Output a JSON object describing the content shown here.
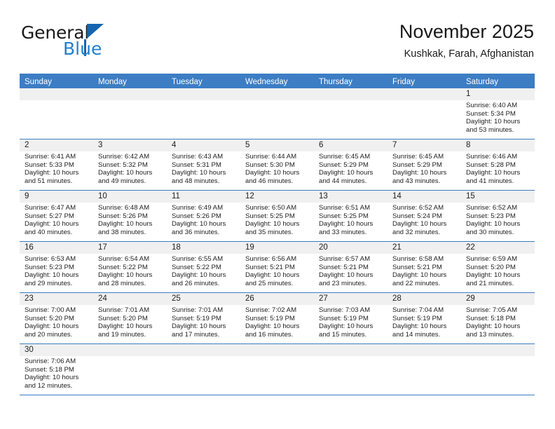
{
  "brand": {
    "name_part1": "General",
    "name_part2": "Blue",
    "accent_color": "#1f7fd1",
    "triangle_color": "#1565b0"
  },
  "header": {
    "title": "November 2025",
    "location": "Kushkak, Farah, Afghanistan"
  },
  "calendar": {
    "header_bg": "#3c7dc4",
    "day_band_bg": "#f0f0f0",
    "weekdays": [
      "Sunday",
      "Monday",
      "Tuesday",
      "Wednesday",
      "Thursday",
      "Friday",
      "Saturday"
    ],
    "weeks": [
      [
        {
          "day": "",
          "sunrise": "",
          "sunset": "",
          "daylight": "",
          "empty": true
        },
        {
          "day": "",
          "sunrise": "",
          "sunset": "",
          "daylight": "",
          "empty": true
        },
        {
          "day": "",
          "sunrise": "",
          "sunset": "",
          "daylight": "",
          "empty": true
        },
        {
          "day": "",
          "sunrise": "",
          "sunset": "",
          "daylight": "",
          "empty": true
        },
        {
          "day": "",
          "sunrise": "",
          "sunset": "",
          "daylight": "",
          "empty": true
        },
        {
          "day": "",
          "sunrise": "",
          "sunset": "",
          "daylight": "",
          "empty": true
        },
        {
          "day": "1",
          "sunrise": "Sunrise: 6:40 AM",
          "sunset": "Sunset: 5:34 PM",
          "daylight": "Daylight: 10 hours and 53 minutes.",
          "empty": false
        }
      ],
      [
        {
          "day": "2",
          "sunrise": "Sunrise: 6:41 AM",
          "sunset": "Sunset: 5:33 PM",
          "daylight": "Daylight: 10 hours and 51 minutes.",
          "empty": false
        },
        {
          "day": "3",
          "sunrise": "Sunrise: 6:42 AM",
          "sunset": "Sunset: 5:32 PM",
          "daylight": "Daylight: 10 hours and 49 minutes.",
          "empty": false
        },
        {
          "day": "4",
          "sunrise": "Sunrise: 6:43 AM",
          "sunset": "Sunset: 5:31 PM",
          "daylight": "Daylight: 10 hours and 48 minutes.",
          "empty": false
        },
        {
          "day": "5",
          "sunrise": "Sunrise: 6:44 AM",
          "sunset": "Sunset: 5:30 PM",
          "daylight": "Daylight: 10 hours and 46 minutes.",
          "empty": false
        },
        {
          "day": "6",
          "sunrise": "Sunrise: 6:45 AM",
          "sunset": "Sunset: 5:29 PM",
          "daylight": "Daylight: 10 hours and 44 minutes.",
          "empty": false
        },
        {
          "day": "7",
          "sunrise": "Sunrise: 6:45 AM",
          "sunset": "Sunset: 5:29 PM",
          "daylight": "Daylight: 10 hours and 43 minutes.",
          "empty": false
        },
        {
          "day": "8",
          "sunrise": "Sunrise: 6:46 AM",
          "sunset": "Sunset: 5:28 PM",
          "daylight": "Daylight: 10 hours and 41 minutes.",
          "empty": false
        }
      ],
      [
        {
          "day": "9",
          "sunrise": "Sunrise: 6:47 AM",
          "sunset": "Sunset: 5:27 PM",
          "daylight": "Daylight: 10 hours and 40 minutes.",
          "empty": false
        },
        {
          "day": "10",
          "sunrise": "Sunrise: 6:48 AM",
          "sunset": "Sunset: 5:26 PM",
          "daylight": "Daylight: 10 hours and 38 minutes.",
          "empty": false
        },
        {
          "day": "11",
          "sunrise": "Sunrise: 6:49 AM",
          "sunset": "Sunset: 5:26 PM",
          "daylight": "Daylight: 10 hours and 36 minutes.",
          "empty": false
        },
        {
          "day": "12",
          "sunrise": "Sunrise: 6:50 AM",
          "sunset": "Sunset: 5:25 PM",
          "daylight": "Daylight: 10 hours and 35 minutes.",
          "empty": false
        },
        {
          "day": "13",
          "sunrise": "Sunrise: 6:51 AM",
          "sunset": "Sunset: 5:25 PM",
          "daylight": "Daylight: 10 hours and 33 minutes.",
          "empty": false
        },
        {
          "day": "14",
          "sunrise": "Sunrise: 6:52 AM",
          "sunset": "Sunset: 5:24 PM",
          "daylight": "Daylight: 10 hours and 32 minutes.",
          "empty": false
        },
        {
          "day": "15",
          "sunrise": "Sunrise: 6:52 AM",
          "sunset": "Sunset: 5:23 PM",
          "daylight": "Daylight: 10 hours and 30 minutes.",
          "empty": false
        }
      ],
      [
        {
          "day": "16",
          "sunrise": "Sunrise: 6:53 AM",
          "sunset": "Sunset: 5:23 PM",
          "daylight": "Daylight: 10 hours and 29 minutes.",
          "empty": false
        },
        {
          "day": "17",
          "sunrise": "Sunrise: 6:54 AM",
          "sunset": "Sunset: 5:22 PM",
          "daylight": "Daylight: 10 hours and 28 minutes.",
          "empty": false
        },
        {
          "day": "18",
          "sunrise": "Sunrise: 6:55 AM",
          "sunset": "Sunset: 5:22 PM",
          "daylight": "Daylight: 10 hours and 26 minutes.",
          "empty": false
        },
        {
          "day": "19",
          "sunrise": "Sunrise: 6:56 AM",
          "sunset": "Sunset: 5:21 PM",
          "daylight": "Daylight: 10 hours and 25 minutes.",
          "empty": false
        },
        {
          "day": "20",
          "sunrise": "Sunrise: 6:57 AM",
          "sunset": "Sunset: 5:21 PM",
          "daylight": "Daylight: 10 hours and 23 minutes.",
          "empty": false
        },
        {
          "day": "21",
          "sunrise": "Sunrise: 6:58 AM",
          "sunset": "Sunset: 5:21 PM",
          "daylight": "Daylight: 10 hours and 22 minutes.",
          "empty": false
        },
        {
          "day": "22",
          "sunrise": "Sunrise: 6:59 AM",
          "sunset": "Sunset: 5:20 PM",
          "daylight": "Daylight: 10 hours and 21 minutes.",
          "empty": false
        }
      ],
      [
        {
          "day": "23",
          "sunrise": "Sunrise: 7:00 AM",
          "sunset": "Sunset: 5:20 PM",
          "daylight": "Daylight: 10 hours and 20 minutes.",
          "empty": false
        },
        {
          "day": "24",
          "sunrise": "Sunrise: 7:01 AM",
          "sunset": "Sunset: 5:20 PM",
          "daylight": "Daylight: 10 hours and 19 minutes.",
          "empty": false
        },
        {
          "day": "25",
          "sunrise": "Sunrise: 7:01 AM",
          "sunset": "Sunset: 5:19 PM",
          "daylight": "Daylight: 10 hours and 17 minutes.",
          "empty": false
        },
        {
          "day": "26",
          "sunrise": "Sunrise: 7:02 AM",
          "sunset": "Sunset: 5:19 PM",
          "daylight": "Daylight: 10 hours and 16 minutes.",
          "empty": false
        },
        {
          "day": "27",
          "sunrise": "Sunrise: 7:03 AM",
          "sunset": "Sunset: 5:19 PM",
          "daylight": "Daylight: 10 hours and 15 minutes.",
          "empty": false
        },
        {
          "day": "28",
          "sunrise": "Sunrise: 7:04 AM",
          "sunset": "Sunset: 5:19 PM",
          "daylight": "Daylight: 10 hours and 14 minutes.",
          "empty": false
        },
        {
          "day": "29",
          "sunrise": "Sunrise: 7:05 AM",
          "sunset": "Sunset: 5:18 PM",
          "daylight": "Daylight: 10 hours and 13 minutes.",
          "empty": false
        }
      ],
      [
        {
          "day": "30",
          "sunrise": "Sunrise: 7:06 AM",
          "sunset": "Sunset: 5:18 PM",
          "daylight": "Daylight: 10 hours and 12 minutes.",
          "empty": false
        },
        {
          "day": "",
          "sunrise": "",
          "sunset": "",
          "daylight": "",
          "empty": true
        },
        {
          "day": "",
          "sunrise": "",
          "sunset": "",
          "daylight": "",
          "empty": true
        },
        {
          "day": "",
          "sunrise": "",
          "sunset": "",
          "daylight": "",
          "empty": true
        },
        {
          "day": "",
          "sunrise": "",
          "sunset": "",
          "daylight": "",
          "empty": true
        },
        {
          "day": "",
          "sunrise": "",
          "sunset": "",
          "daylight": "",
          "empty": true
        },
        {
          "day": "",
          "sunrise": "",
          "sunset": "",
          "daylight": "",
          "empty": true
        }
      ]
    ]
  }
}
